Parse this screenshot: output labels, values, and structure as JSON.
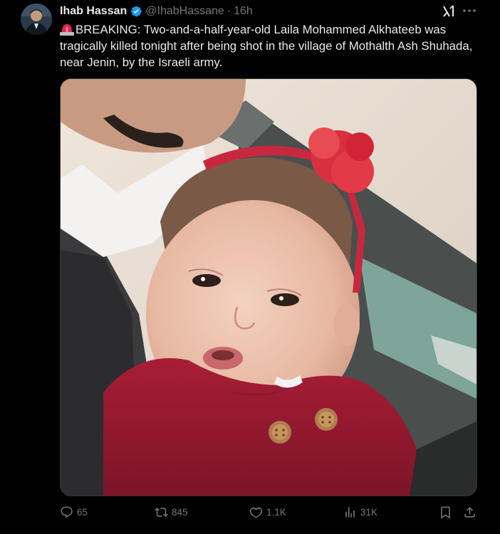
{
  "author": {
    "name": "Ihab Hassan",
    "handle": "@IhabHassane",
    "separator": "·",
    "time": "16h",
    "verified": true
  },
  "tweet": {
    "text": "BREAKING: Two-and-a-half-year-old Laila Mohammed Alkhateeb was tragically killed tonight after being shot in the village of Mothalth Ash Shuhada, near Jenin, by the Israeli army."
  },
  "icons": {
    "verified": "verified-badge-icon",
    "grok": "grok-icon",
    "more": "more-options-icon",
    "siren": "siren-emoji-icon",
    "reply": "reply-icon",
    "retweet": "retweet-icon",
    "like": "heart-icon",
    "views": "views-icon",
    "bookmark": "bookmark-icon",
    "share": "share-icon"
  },
  "actions": {
    "replies": "65",
    "retweets": "845",
    "likes": "1.1K",
    "views": "31K"
  },
  "colors": {
    "background": "#000000",
    "text": "#e7e9ea",
    "muted": "#71767b",
    "verified": "#1d9bf0",
    "border": "#2f3336"
  }
}
